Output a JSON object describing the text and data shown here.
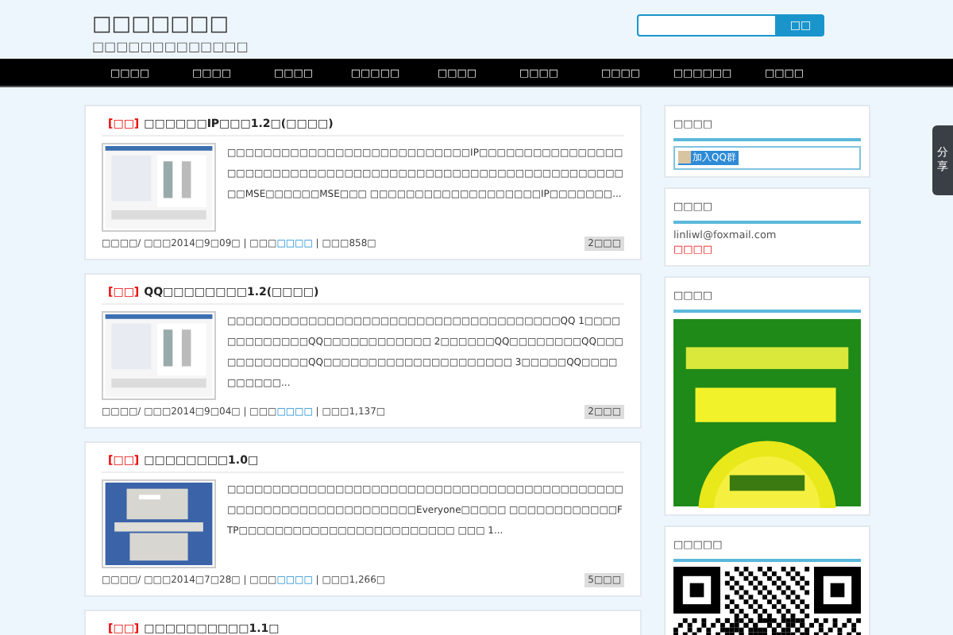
{
  "header": {
    "site_title": "□□□□□□□",
    "tagline": "□□□□□□□□□□□□□",
    "search": {
      "button": "□□"
    }
  },
  "nav": [
    "□□□□",
    "□□□□",
    "□□□□",
    "□□□□□",
    "□□□□",
    "□□□□",
    "□□□□",
    "□□□□□□",
    "□□□□"
  ],
  "posts": [
    {
      "tag": "[□□]",
      "title": "□□□□□□IP□□□1.2□(□□□□)",
      "excerpt": "□□□□□□□□□□□□□□□□□□□□□□□□□□□IP□□□□□□□□□□□□□□□□□□□□□□□□□□□□□□□□□□□□□□□□□□□□□□□□□□□□□□□□□□□□□□MSE□□□□□□MSE□□□ □□□□□□□□□□□□□□□□□□□IP□□□□□□□...",
      "meta_before": "□□□□/ □□□2014□9□09□ | □□□",
      "meta_link": "□□□□",
      "meta_after": " | □□□858□",
      "comments": "2□□□"
    },
    {
      "tag": "[□□]",
      "title": "QQ□□□□□□□□1.2(□□□□)",
      "excerpt": "□□□□□□□□□□□□□□□□□□□□□□□□□□□□□□□□□□□□□QQ 1□□□□□□□□□□□□□QQ□□□□□□□□□□□□ 2□□□□□□QQ□□□□□□□□QQ□□□□□□□□□□□□QQ□□□□□□□□□□□□□□□□□□□□□ 3□□□□□QQ□□□□□□□□□□...",
      "meta_before": "□□□□/ □□□2014□9□04□ | □□□",
      "meta_link": "□□□□",
      "meta_after": " | □□□1,137□",
      "comments": "2□□□"
    },
    {
      "tag": "[□□]",
      "title": "□□□□□□□□1.0□",
      "excerpt": "□□□□□□□□□□□□□□□□□□□□□□□□□□□□□□□□□□□□□□□□□□□□□□□□□□□□□□□□□□□□□□□□□Everyone□□□□□ □□□□□□□□□□□□FTP□□□□□□□□□□□□□□□□□□□□□□□□ □□□ 1...",
      "meta_before": "□□□□/ □□□2014□7□28□ | □□□",
      "meta_link": "□□□□",
      "meta_after": " | □□□1,266□",
      "comments": "5□□□"
    },
    {
      "tag": "[□□]",
      "title": "□□□□□□□□□□1.1□"
    }
  ],
  "sidebar": [
    {
      "kind": "qq",
      "title": "□□□□",
      "button": "加入QQ群"
    },
    {
      "kind": "contact",
      "title": "□□□□",
      "email": "linliwl@foxmail.com",
      "note": "□□□□"
    },
    {
      "kind": "ad",
      "title": "□□□□"
    },
    {
      "kind": "qr",
      "title": "□□□□□"
    }
  ],
  "share_tab": "分享"
}
